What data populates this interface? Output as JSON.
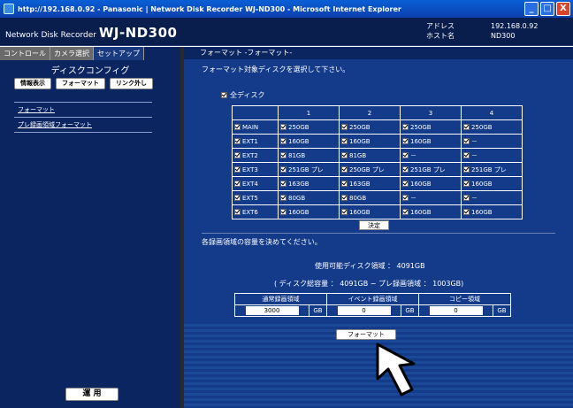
{
  "window": {
    "title": "http://192.168.0.92 - Panasonic | Network Disk Recorder WJ-ND300 - Microsoft Internet Explorer",
    "minimize": "_",
    "maximize": "□",
    "close": "X"
  },
  "header": {
    "brand_prefix": "Network Disk Recorder ",
    "brand_model": "WJ-ND300",
    "address_label": "アドレス",
    "host_label": "ホスト名",
    "address_value": "192.168.0.92",
    "host_value": "ND300"
  },
  "nav": {
    "tabs": [
      "コントロール",
      "カメラ選択",
      "セットアップ"
    ],
    "section_title": "ディスクコンフィグ",
    "buttons": [
      "情報表示",
      "フォーマット",
      "リンク外し"
    ],
    "links": [
      "フォーマット",
      "プレ録画領域フォーマット"
    ],
    "run_button": "運 用"
  },
  "main": {
    "section_bar": "フォーマット -フォーマット-",
    "instruction": "フォーマット対象ディスクを選択して下さい。",
    "all_disks": "全ディスク",
    "columns": [
      "",
      "1",
      "2",
      "3",
      "4"
    ],
    "rows": [
      [
        "MAIN",
        "250GB",
        "250GB",
        "250GB",
        "250GB"
      ],
      [
        "EXT1",
        "160GB",
        "160GB",
        "160GB",
        "－"
      ],
      [
        "EXT2",
        "81GB",
        "81GB",
        "－",
        "－"
      ],
      [
        "EXT3",
        "251GB プレ",
        "250GB プレ",
        "251GB プレ",
        "251GB プレ"
      ],
      [
        "EXT4",
        "163GB",
        "163GB",
        "160GB",
        "160GB"
      ],
      [
        "EXT5",
        "80GB",
        "80GB",
        "－",
        "－"
      ],
      [
        "EXT6",
        "160GB",
        "160GB",
        "160GB",
        "160GB"
      ]
    ],
    "decide_button": "決定",
    "capacity_instruction": "各録画領域の容量を決めてください。",
    "available_text": "使用可能ディスク領域 ： 4091GB",
    "total_text": "( ディスク総容量 ： 4091GB − プレ録画領域 ： 1003GB)",
    "capacity_headers": [
      "通常録画領域",
      "イベント録画領域",
      "コピー領域"
    ],
    "capacity_values": [
      "3000",
      "0",
      "0"
    ],
    "unit": "GB",
    "format_button": "フォーマット"
  }
}
